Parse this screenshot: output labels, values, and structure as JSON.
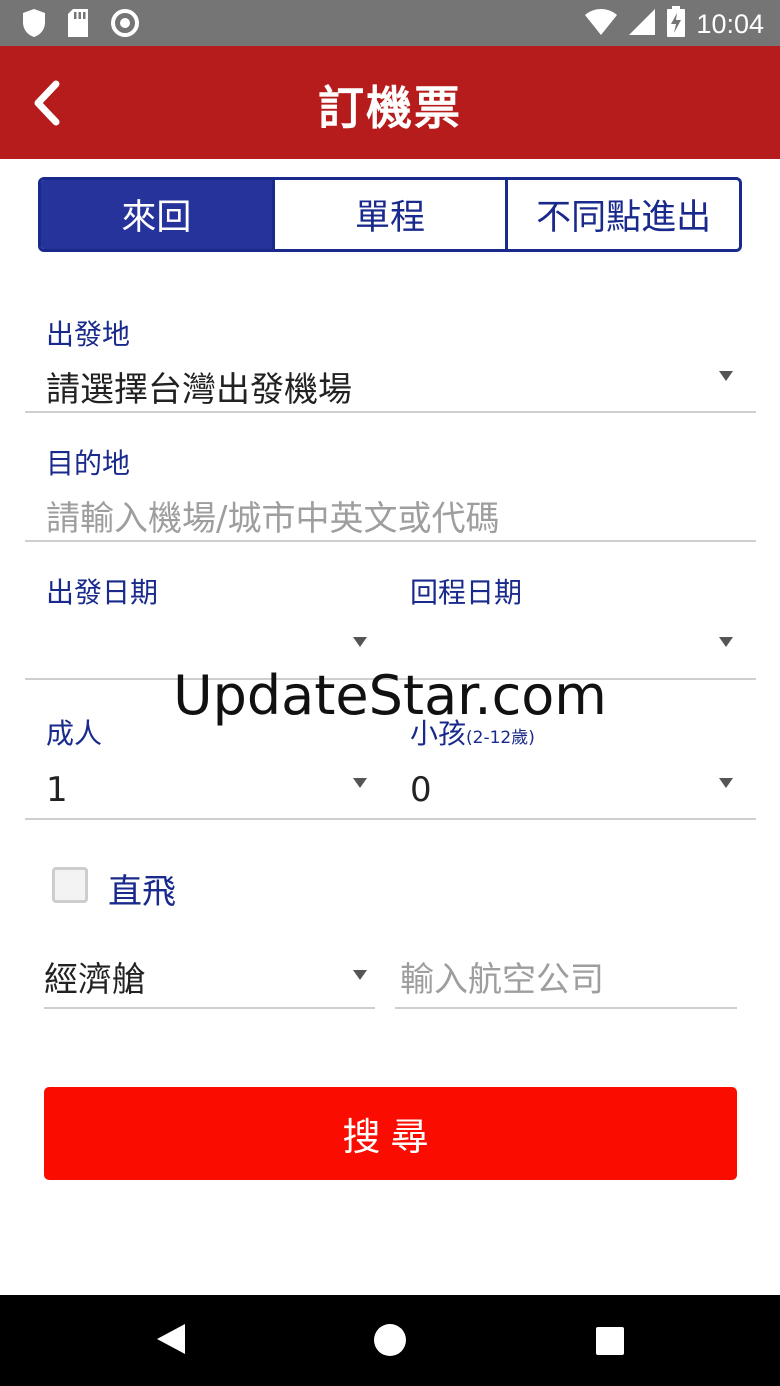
{
  "status_bar": {
    "time": "10:04",
    "left_icons": [
      "shield-icon",
      "sd-card-icon",
      "circle-icon"
    ],
    "right_icons": [
      "wifi-icon",
      "signal-icon",
      "battery-charging-icon"
    ]
  },
  "app_bar": {
    "title": "訂機票",
    "background": "#b71c1c"
  },
  "trip_tabs": [
    {
      "label": "來回",
      "active": true
    },
    {
      "label": "單程",
      "active": false
    },
    {
      "label": "不同點進出",
      "active": false
    }
  ],
  "departure": {
    "label": "出發地",
    "value": "請選擇台灣出發機場"
  },
  "destination": {
    "label": "目的地",
    "placeholder": "請輸入機場/城市中英文或代碼"
  },
  "dates": {
    "depart_label": "出發日期",
    "return_label": "回程日期"
  },
  "passengers": {
    "adult_label": "成人",
    "adult_value": "1",
    "child_label": "小孩",
    "child_hint": "(2-12歲)",
    "child_value": "0"
  },
  "direct_flight": {
    "label": "直飛",
    "checked": false
  },
  "cabin": {
    "value": "經濟艙"
  },
  "airline": {
    "placeholder": "輸入航空公司"
  },
  "search_button": {
    "label": "搜尋",
    "color": "#fa0d00"
  },
  "watermark": "UpdateStar.com",
  "colors": {
    "accent": "#1a2a8c",
    "active_tab": "#26339a"
  }
}
